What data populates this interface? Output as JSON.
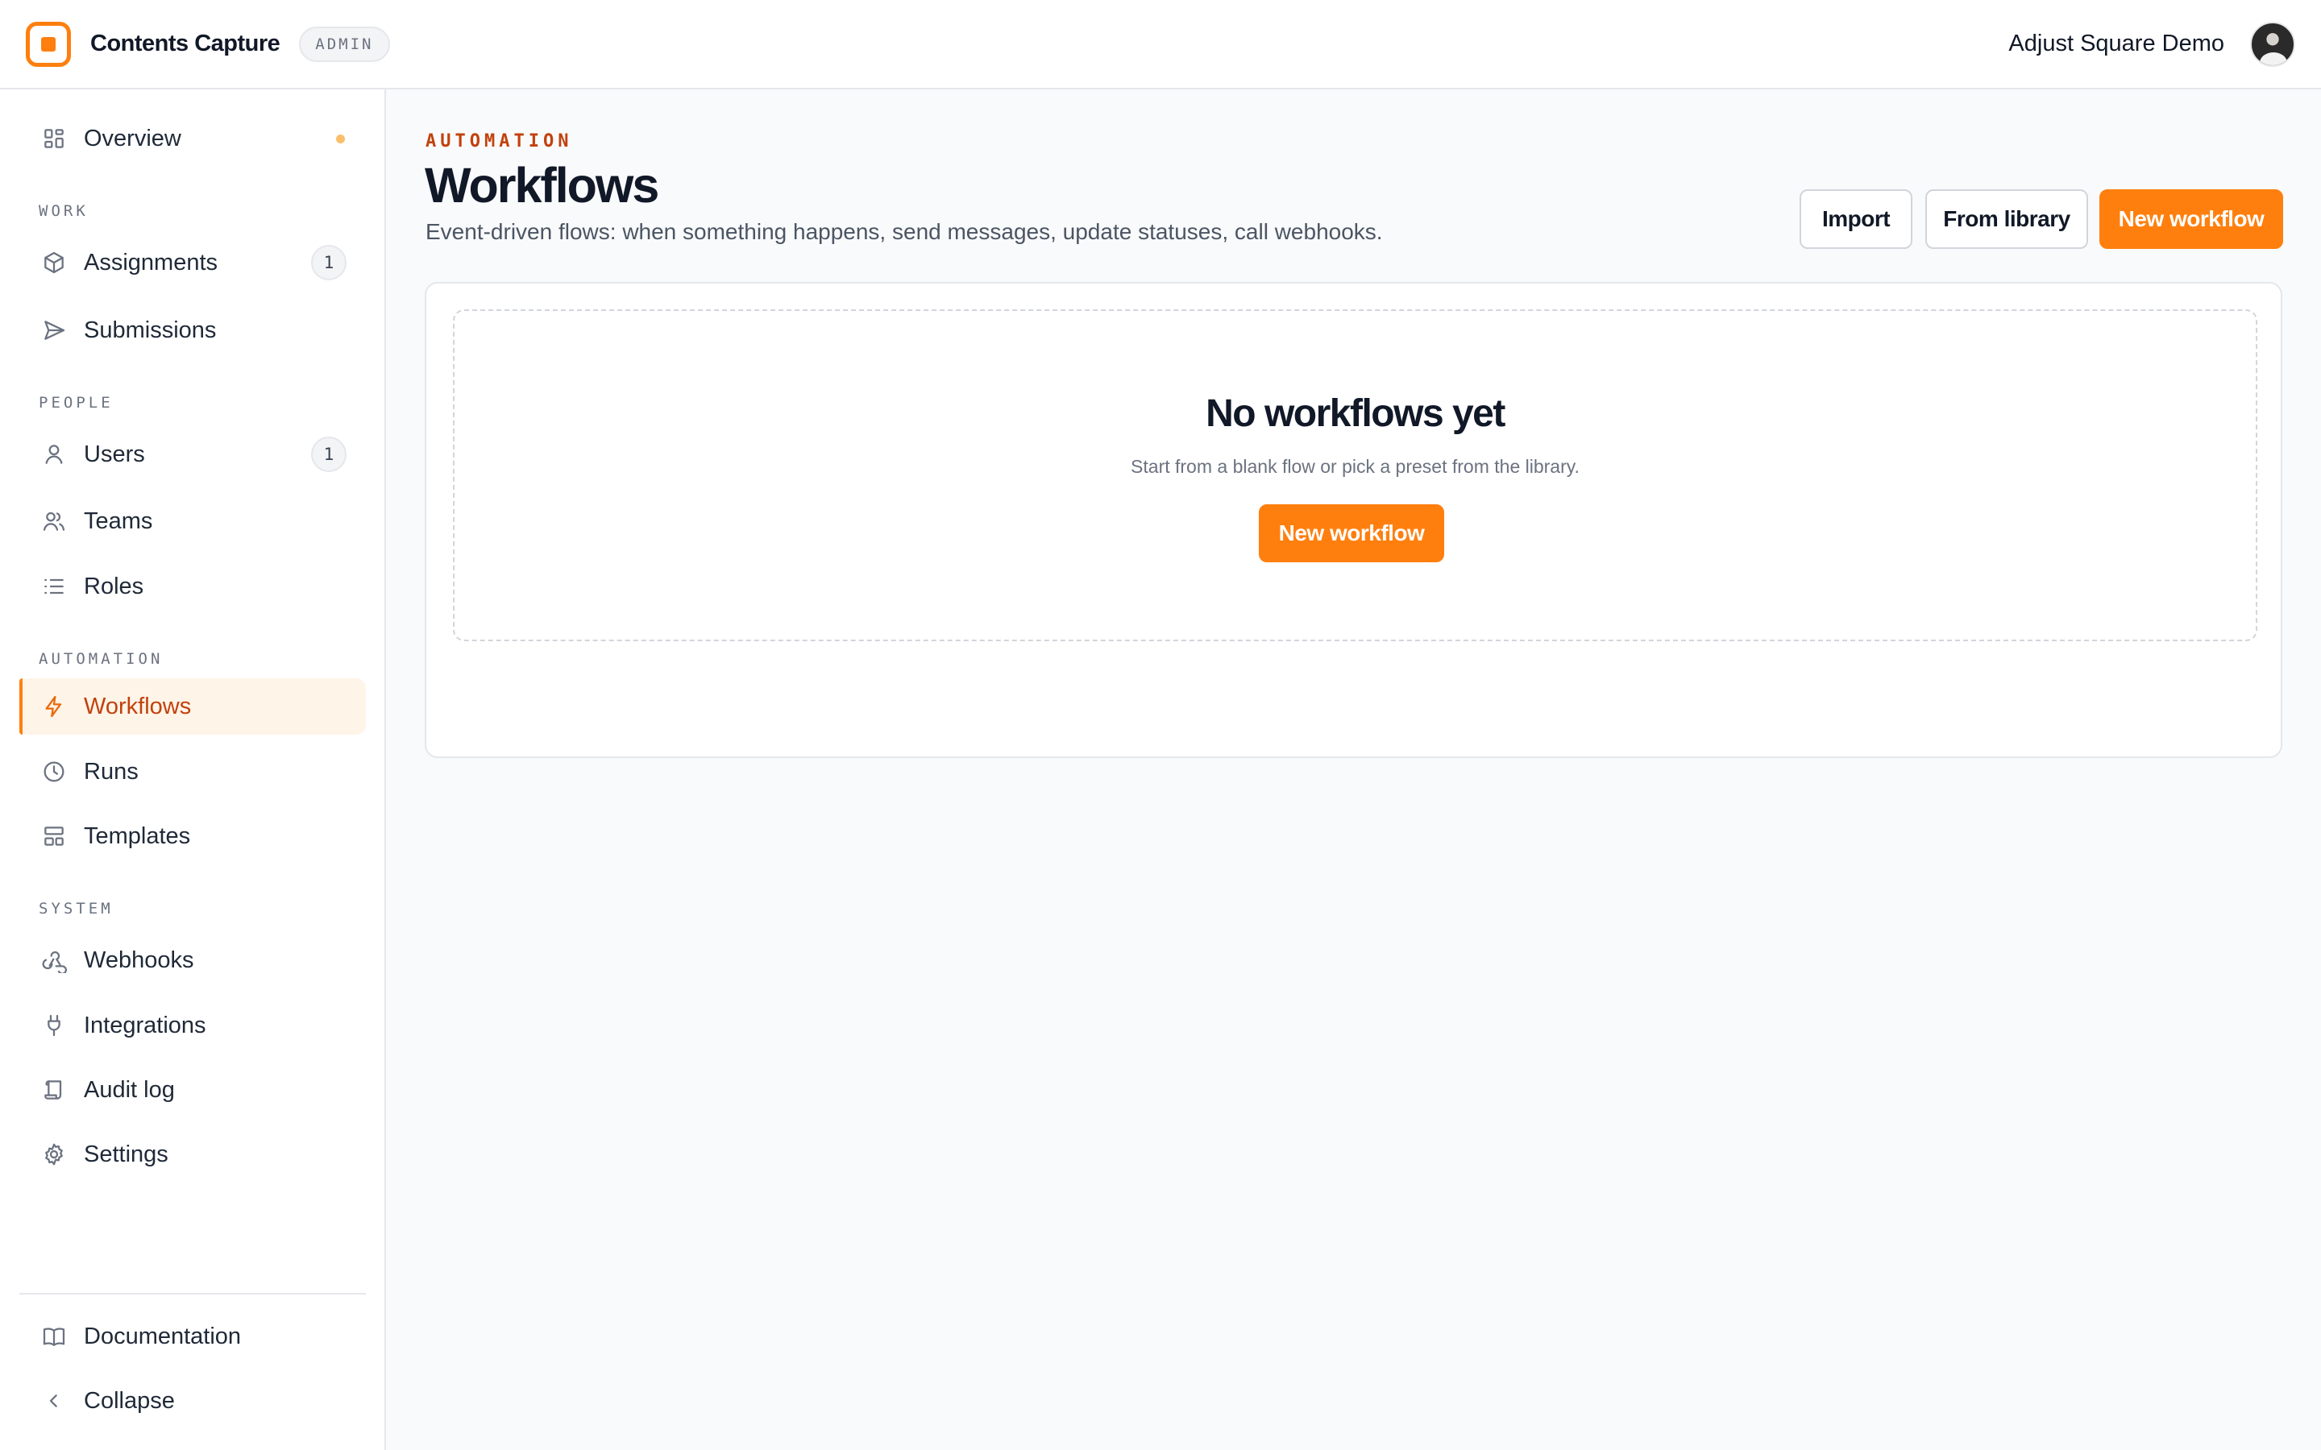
{
  "app": {
    "name": "Contents Capture",
    "role_badge": "ADMIN",
    "workspace": "Adjust Square Demo"
  },
  "sidebar": {
    "overview": {
      "label": "Overview",
      "icon": "grid-icon"
    },
    "sections": {
      "work": "WORK",
      "people": "PEOPLE",
      "automation": "AUTOMATION",
      "system": "SYSTEM"
    },
    "items": {
      "assignments": {
        "label": "Assignments",
        "icon": "cube-icon",
        "count": "1"
      },
      "submissions": {
        "label": "Submissions",
        "icon": "send-icon"
      },
      "users": {
        "label": "Users",
        "icon": "user-icon",
        "count": "1"
      },
      "teams": {
        "label": "Teams",
        "icon": "users-icon"
      },
      "roles": {
        "label": "Roles",
        "icon": "list-icon"
      },
      "workflows": {
        "label": "Workflows",
        "icon": "bolt-icon",
        "active": true
      },
      "runs": {
        "label": "Runs",
        "icon": "clock-icon"
      },
      "templates": {
        "label": "Templates",
        "icon": "layout-icon"
      },
      "webhooks": {
        "label": "Webhooks",
        "icon": "webhook-icon"
      },
      "integrations": {
        "label": "Integrations",
        "icon": "plug-icon"
      },
      "audit_log": {
        "label": "Audit log",
        "icon": "scroll-icon"
      },
      "settings": {
        "label": "Settings",
        "icon": "gear-icon"
      }
    },
    "footer": {
      "documentation": {
        "label": "Documentation",
        "icon": "book-icon"
      },
      "collapse": {
        "label": "Collapse",
        "icon": "chevron-left-icon"
      }
    }
  },
  "page": {
    "eyebrow": "AUTOMATION",
    "title": "Workflows",
    "description": "Event-driven flows: when something happens, send messages, update statuses, call webhooks.",
    "actions": {
      "import": "Import",
      "from_library": "From library",
      "new_workflow": "New workflow"
    }
  },
  "empty_state": {
    "title": "No workflows yet",
    "description": "Start from a blank flow or pick a preset from the library.",
    "button": "New workflow"
  },
  "colors": {
    "accent": "#ff7f0e",
    "accent_text": "#c2410c",
    "active_bg": "#fff4e8"
  }
}
